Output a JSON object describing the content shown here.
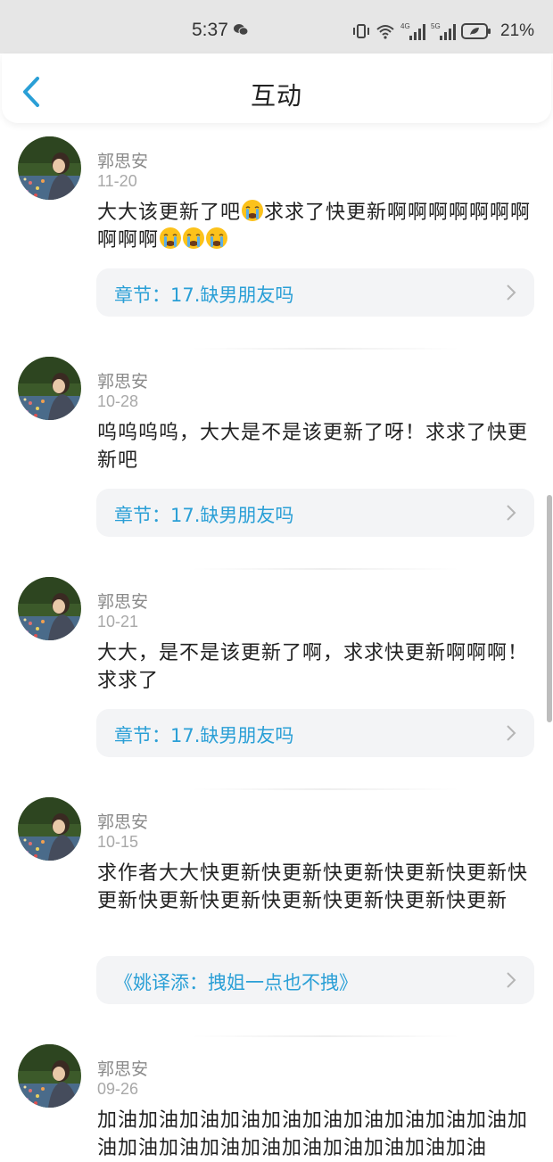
{
  "status_bar": {
    "time": "5:37",
    "battery": "21%"
  },
  "header": {
    "title": "互动"
  },
  "comments": [
    {
      "author": "郭思安",
      "date": "11-20",
      "text_a": "大大该更新了吧",
      "text_b": "求求了快更新啊啊啊啊啊啊啊啊啊啊",
      "link": "章节：17.缺男朋友吗"
    },
    {
      "author": "郭思安",
      "date": "10-28",
      "text": "呜呜呜呜，大大是不是该更新了呀！求求了快更新吧",
      "link": "章节：17.缺男朋友吗"
    },
    {
      "author": "郭思安",
      "date": "10-21",
      "text": "大大，是不是该更新了啊，求求快更新啊啊啊！求求了",
      "link": "章节：17.缺男朋友吗"
    },
    {
      "author": "郭思安",
      "date": "10-15",
      "text": "求作者大大快更新快更新快更新快更新快更新快更新快更新快更新快更新快更新快更新快更新",
      "link": "《姚译添：拽姐一点也不拽》"
    },
    {
      "author": "郭思安",
      "date": "09-26",
      "text": "加油加油加油加油加油加油加油加油加油加油加油加油加油加油加油加油加油加油加油加油"
    }
  ],
  "icons": {
    "back": "chevron-left-icon",
    "chevron": "chevron-right-icon",
    "emoji": "crying-face-icon"
  },
  "colors": {
    "accent": "#2a9fd6",
    "link_bg": "#f3f4f6",
    "status_bar_bg": "#e6e6e6"
  }
}
